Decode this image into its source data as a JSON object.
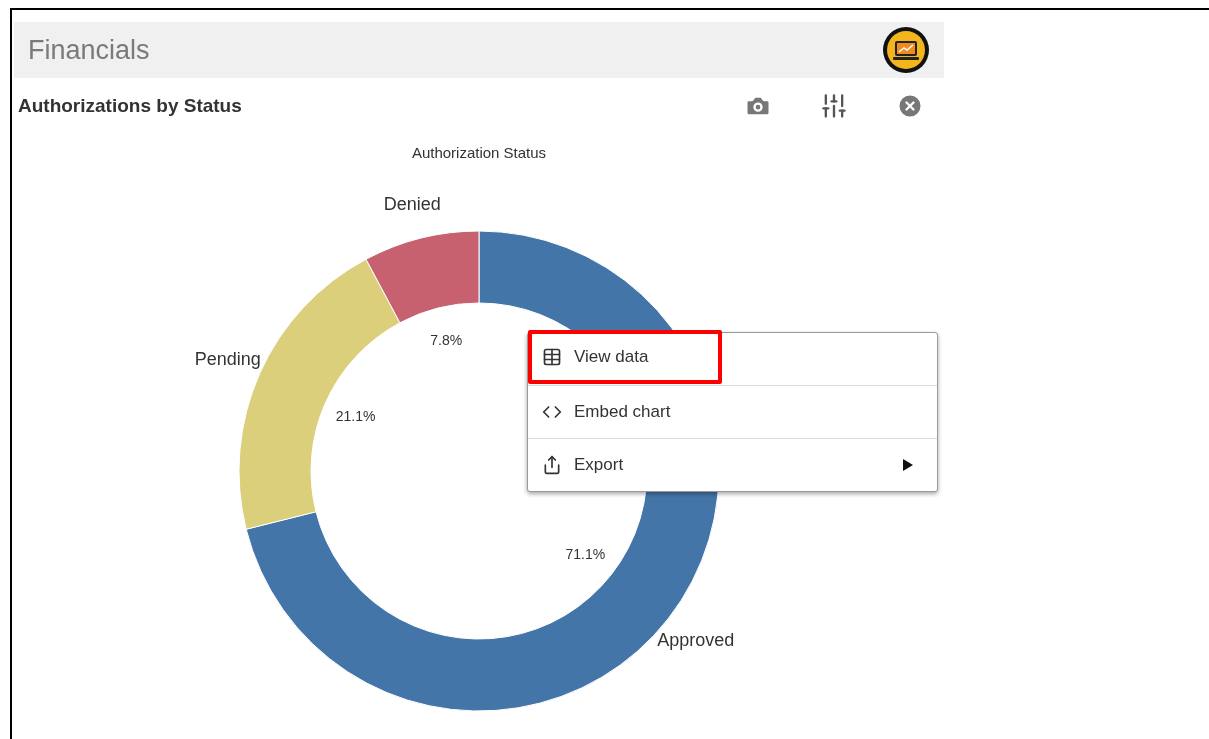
{
  "app": {
    "title": "Financials"
  },
  "panel": {
    "title": "Authorizations by Status",
    "chart_data": {
      "type": "donut",
      "title": "Authorization Status",
      "categories": [
        "Approved",
        "Pending",
        "Denied"
      ],
      "values": [
        71.1,
        21.1,
        7.8
      ],
      "colors": [
        "#4475a8",
        "#dccf7b",
        "#c8616f"
      ],
      "value_labels": [
        "71.1%",
        "21.1%",
        "7.8%"
      ]
    }
  },
  "context_menu": {
    "items": [
      {
        "label": "View data",
        "kind": "table",
        "submenu": false,
        "highlighted": true
      },
      {
        "label": "Embed chart",
        "kind": "code",
        "submenu": false,
        "highlighted": false
      },
      {
        "label": "Export",
        "kind": "export",
        "submenu": true,
        "highlighted": false
      }
    ]
  }
}
